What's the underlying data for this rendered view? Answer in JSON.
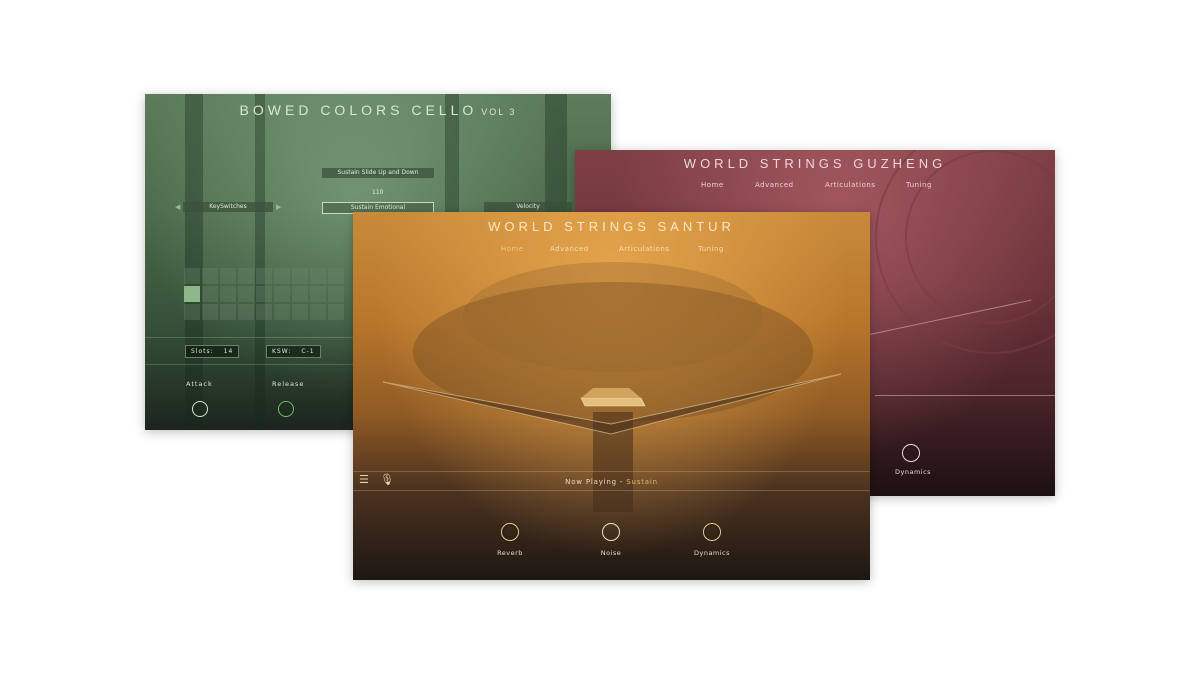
{
  "cello": {
    "title": "BOWED COLORS CELLO",
    "volume": "VOL 3",
    "articulation_top": "Sustain Slide Up and Down",
    "value_110": "110",
    "keyswitches_label": "KeySwitches",
    "articulation_selected": "Sustain Emotional",
    "velocity_label": "Velocity",
    "slots_label": "Slots:",
    "slots_value": "14",
    "ksw_label": "KSW:",
    "ksw_value": "C-1",
    "attack_label": "Attack",
    "release_label": "Release",
    "accent_color": "#6fbf6d"
  },
  "guzheng": {
    "title": "WORLD STRINGS GUZHENG",
    "nav": [
      "Home",
      "Advanced",
      "Articulations",
      "Tuning"
    ],
    "dynamics_label": "Dynamics",
    "accent_color": "#7e3f45"
  },
  "santur": {
    "title": "WORLD STRINGS SANTUR",
    "nav": [
      "Home",
      "Advanced",
      "Articulations",
      "Tuning"
    ],
    "icons": [
      "mixer-icon",
      "microphone-icon"
    ],
    "now_playing_label": "Now Playing",
    "now_playing_sep": "-",
    "now_playing_value": "Sustain",
    "knobs": [
      "Reverb",
      "Noise",
      "Dynamics"
    ],
    "accent_color": "#e2b673"
  }
}
